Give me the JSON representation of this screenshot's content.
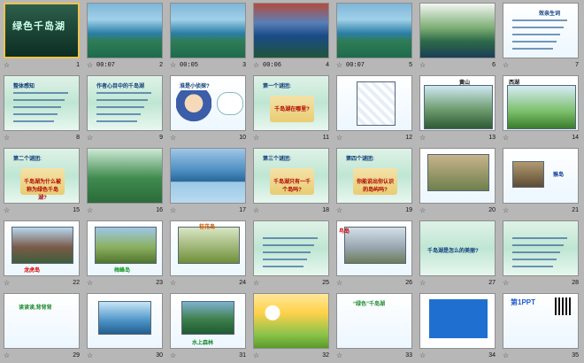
{
  "slides": [
    {
      "num": "1",
      "dur": "",
      "title": "绿色千岛湖",
      "art": "lake-title"
    },
    {
      "num": "2",
      "dur": "00:07",
      "title": "",
      "art": "lake"
    },
    {
      "num": "3",
      "dur": "00:05",
      "title": "",
      "art": "lake"
    },
    {
      "num": "4",
      "dur": "00:06",
      "title": "",
      "art": "lake-dark"
    },
    {
      "num": "5",
      "dur": "00:07",
      "title": "",
      "art": "lake"
    },
    {
      "num": "6",
      "dur": "",
      "title": "",
      "art": "islands"
    },
    {
      "num": "7",
      "dur": "",
      "title": "效亲生词",
      "art": "vocab"
    },
    {
      "num": "8",
      "dur": "",
      "title": "整体感知",
      "art": "q"
    },
    {
      "num": "9",
      "dur": "",
      "title": "作者心目中的千岛湖",
      "art": "text"
    },
    {
      "num": "10",
      "dur": "",
      "title": "淮是小侦探?",
      "art": "cartoon"
    },
    {
      "num": "11",
      "dur": "",
      "title": "第一个谜团:",
      "art": "scroll",
      "scroll": "千岛湖在哪里?"
    },
    {
      "num": "12",
      "dur": "",
      "title": "",
      "art": "map"
    },
    {
      "num": "13",
      "dur": "",
      "title": "黄山",
      "art": "huangshan"
    },
    {
      "num": "14",
      "dur": "",
      "title": "西湖",
      "art": "xihu"
    },
    {
      "num": "15",
      "dur": "",
      "title": "第二个谜团:",
      "art": "scroll",
      "scroll": "千岛湖为什么被称为绿色千岛湖?"
    },
    {
      "num": "16",
      "dur": "",
      "title": "",
      "art": "green-islands"
    },
    {
      "num": "17",
      "dur": "",
      "title": "",
      "art": "bridge"
    },
    {
      "num": "18",
      "dur": "",
      "title": "第三个谜团:",
      "art": "scroll",
      "scroll": "千岛湖只有一千个岛吗?"
    },
    {
      "num": "19",
      "dur": "",
      "title": "第四个谜团:",
      "art": "scroll",
      "scroll": "你能说出你认识的岛屿吗?"
    },
    {
      "num": "20",
      "dur": "",
      "title": "",
      "art": "monkeys"
    },
    {
      "num": "21",
      "dur": "",
      "title": "猴岛",
      "art": "monkey"
    },
    {
      "num": "22",
      "dur": "",
      "title": "龙虎岛",
      "art": "temple"
    },
    {
      "num": "23",
      "dur": "",
      "title": "梅峰岛",
      "art": "grass"
    },
    {
      "num": "24",
      "dur": "",
      "title": "桂花岛",
      "art": "flowers"
    },
    {
      "num": "25",
      "dur": "",
      "title": "",
      "art": "paragraph"
    },
    {
      "num": "26",
      "dur": "",
      "title": "鸟岛",
      "art": "birds"
    },
    {
      "num": "27",
      "dur": "",
      "title": "千岛湖是怎么的美丽?",
      "art": "plain"
    },
    {
      "num": "28",
      "dur": "",
      "title": "",
      "art": "text2"
    },
    {
      "num": "29",
      "dur": "",
      "title": "读读读,背背背",
      "art": "poem"
    },
    {
      "num": "30",
      "dur": "",
      "title": "",
      "art": "fish"
    },
    {
      "num": "31",
      "dur": "",
      "title": "水上森林",
      "art": "forest"
    },
    {
      "num": "32",
      "dur": "",
      "title": "",
      "art": "sun"
    },
    {
      "num": "33",
      "dur": "",
      "title": "“绿色”千岛湖",
      "art": "green-text"
    },
    {
      "num": "34",
      "dur": "",
      "title": "",
      "art": "blue-box"
    },
    {
      "num": "35",
      "dur": "",
      "title": "第1PPT",
      "art": "brand"
    }
  ],
  "selected": "1"
}
